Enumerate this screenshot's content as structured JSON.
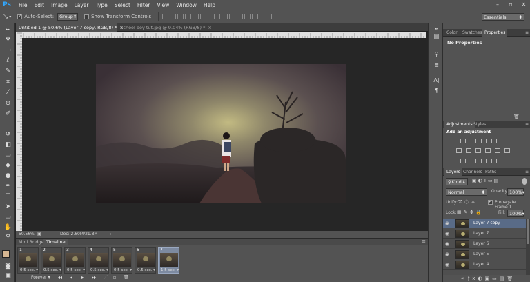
{
  "app": {
    "logo": "Ps"
  },
  "menu": [
    "File",
    "Edit",
    "Image",
    "Layer",
    "Type",
    "Select",
    "Filter",
    "View",
    "Window",
    "Help"
  ],
  "window_controls": [
    "–",
    "▫",
    "✕"
  ],
  "options": {
    "auto_select_label": "Auto-Select:",
    "auto_select_value": "Group",
    "show_transform_label": "Show Transform Controls",
    "workspace": "Essentials"
  },
  "tabs": [
    {
      "label": "Untitled-1 @ 50.6% (Layer 7 copy, RGB/8) *",
      "close": "×"
    },
    {
      "label": "school boy tut.jpg @ 9.04% (RGB/8) *",
      "close": "×"
    }
  ],
  "ruler_ticks": [
    "0",
    "50",
    "100",
    "150",
    "200",
    "250",
    "300",
    "350",
    "400",
    "450",
    "500",
    "550",
    "600",
    "650",
    "700",
    "750",
    "800",
    "850",
    "900",
    "950",
    "1000",
    "1050",
    "1100",
    "1150",
    "1200",
    "1250",
    "1300",
    "1350",
    "1400",
    "1450",
    "1500",
    "1550",
    "1600",
    "1650",
    "1700",
    "1750",
    "1800"
  ],
  "status": {
    "zoom": "50.56%",
    "doc": "Doc: 2.60M/21.8M"
  },
  "bottom_panel": {
    "tabs": [
      "Mini Bridge",
      "Timeline"
    ]
  },
  "timeline": {
    "frames": [
      {
        "num": "1",
        "delay": "0.5 sec."
      },
      {
        "num": "2",
        "delay": "0.5 sec."
      },
      {
        "num": "3",
        "delay": "0.5 sec."
      },
      {
        "num": "4",
        "delay": "0.5 sec."
      },
      {
        "num": "5",
        "delay": "0.5 sec."
      },
      {
        "num": "6",
        "delay": "0.5 sec."
      },
      {
        "num": "7",
        "delay": "1.5 sec."
      }
    ],
    "loop": "Forever"
  },
  "panels": {
    "properties_tabs": [
      "Color",
      "Swatches",
      "Properties"
    ],
    "properties_msg": "No Properties",
    "adjust_tabs": [
      "Adjustments",
      "Styles"
    ],
    "adjust_msg": "Add an adjustment",
    "layer_tabs": [
      "Layers",
      "Channels",
      "Paths"
    ],
    "kind_label": "Kind",
    "blend_mode": "Normal",
    "opacity_label": "Opacity:",
    "opacity_value": "100%",
    "unify_label": "Unify:",
    "propagate_label": "Propagate Frame 1",
    "lock_label": "Lock:",
    "fill_label": "Fill:",
    "fill_value": "100%",
    "layers": [
      "Layer 7 copy",
      "Layer 7",
      "Layer 6",
      "Layer 5",
      "Layer 4"
    ]
  },
  "colors": {
    "accent": "#31a8ff",
    "selected_layer": "#596b87",
    "selected_frame": "#7d8aa0"
  }
}
